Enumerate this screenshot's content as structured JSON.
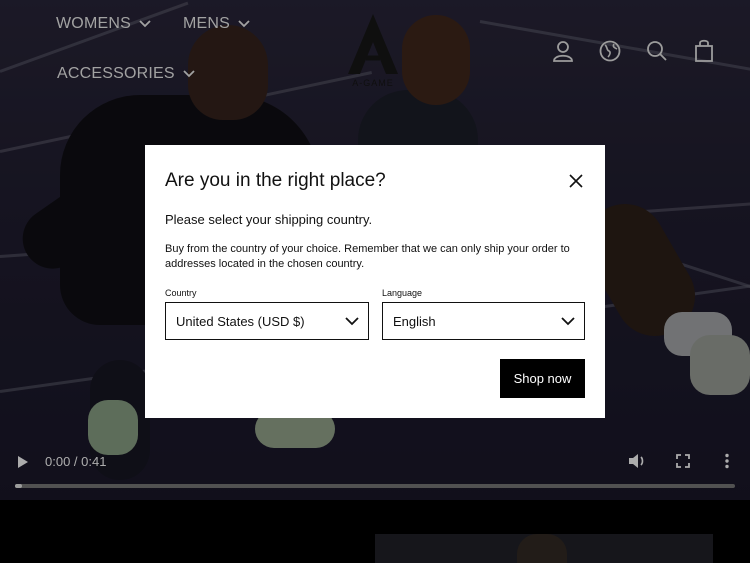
{
  "nav": {
    "womens": "WOMENS",
    "mens": "MENS",
    "accessories": "ACCESSORIES",
    "logo_text": "A-GAME"
  },
  "header_icons": [
    "account-icon",
    "globe-icon",
    "search-icon",
    "bag-icon"
  ],
  "video": {
    "time": "0:00 / 0:41",
    "progress": 0.0
  },
  "modal": {
    "title": "Are you in the right place?",
    "subtitle": "Please select your shipping country.",
    "note": "Buy from the country of your choice. Remember that we can only ship your order to addresses located in the chosen country.",
    "country_label": "Country",
    "country_value": "United States (USD $)",
    "language_label": "Language",
    "language_value": "English",
    "submit_label": "Shop now"
  },
  "colors": {
    "modal_bg": "#ffffff",
    "button_bg": "#000000",
    "button_text": "#ffffff"
  }
}
